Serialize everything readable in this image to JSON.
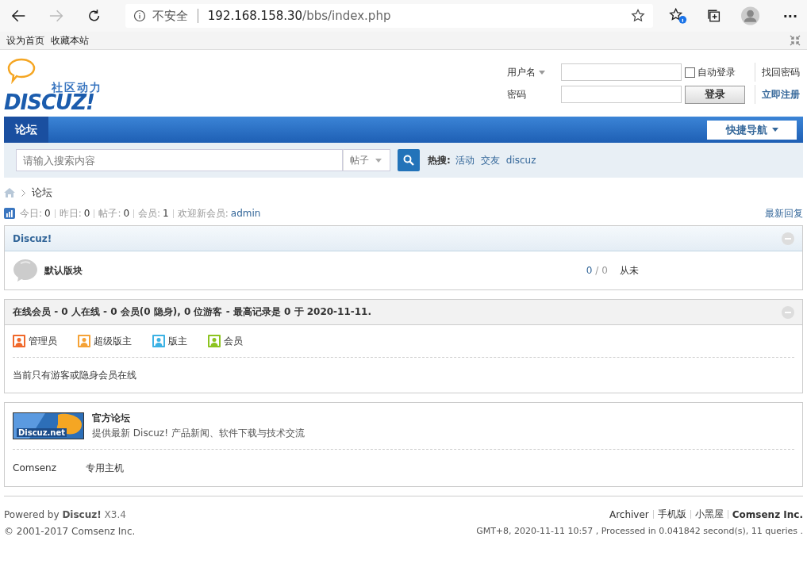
{
  "browser": {
    "security": "不安全",
    "address_host": "192.168.158.30",
    "address_path": "/bbs/index.php",
    "forward_disabled": true,
    "more": "···"
  },
  "favorites_bar": [
    "设为首页",
    "收藏本站"
  ],
  "logo": {
    "tagline": "社区动力",
    "wordmark": "DISCUZ!"
  },
  "login": {
    "username_label": "用户名",
    "password_label": "密码",
    "auto_login": {
      "label": "自动登录",
      "checked": false
    },
    "login_button": "登录",
    "links": [
      "找回密码",
      "立即注册"
    ]
  },
  "nav": {
    "tabs": [
      {
        "label": "论坛",
        "selected": true
      }
    ],
    "quick_nav": "快捷导航"
  },
  "search": {
    "placeholder": "请输入搜索内容",
    "type": "帖子",
    "hot_label": "热搜:",
    "hot": [
      "活动",
      "交友",
      "discuz"
    ]
  },
  "breadcrumb": [
    "论坛"
  ],
  "stats": [
    {
      "label": "今日:",
      "value": "0"
    },
    {
      "label": "昨日:",
      "value": "0"
    },
    {
      "label": "帖子:",
      "value": "0"
    },
    {
      "label": "会员:",
      "value": "1"
    },
    {
      "label": "欢迎新会员:",
      "value": "admin"
    }
  ],
  "latest_replies": "最新回复",
  "category": {
    "title": "Discuz!",
    "forums": [
      {
        "name": "默认版块",
        "threads": "0",
        "separator": "/",
        "posts": "0",
        "last_post": "从未"
      }
    ]
  },
  "online": {
    "title": "在线会员 - 0 人在线 - 0 会员(0 隐身), 0 位游客 - 最高记录是 0 于 2020-11-11.",
    "legend": [
      {
        "label": "管理员",
        "color": "#f0682a"
      },
      {
        "label": "超级版主",
        "color": "#f5a236"
      },
      {
        "label": "版主",
        "color": "#3cb2e4"
      },
      {
        "label": "会员",
        "color": "#8cc420"
      }
    ],
    "note": "当前只有游客或隐身会员在线"
  },
  "links": {
    "featured": {
      "logo_text": "Discuz.net",
      "name": "官方论坛",
      "description": "提供最新 Discuz! 产品新闻、软件下载与技术交流"
    },
    "text_links": [
      "Comsenz",
      "专用主机"
    ]
  },
  "footer": {
    "powered_prefix": "Powered by",
    "powered_name": "Discuz!",
    "version": "X3.4",
    "copyright": "© 2001-2017 Comsenz Inc.",
    "links": [
      {
        "label": "Archiver",
        "kind": "normal"
      },
      {
        "label": "手机版",
        "kind": "normal"
      },
      {
        "label": "小黑屋",
        "kind": "normal"
      },
      {
        "label": "Comsenz Inc.",
        "kind": "strong"
      }
    ],
    "info": "GMT+8, 2020-11-11 10:57 , Processed in 0.041842 second(s), 11 queries ."
  }
}
